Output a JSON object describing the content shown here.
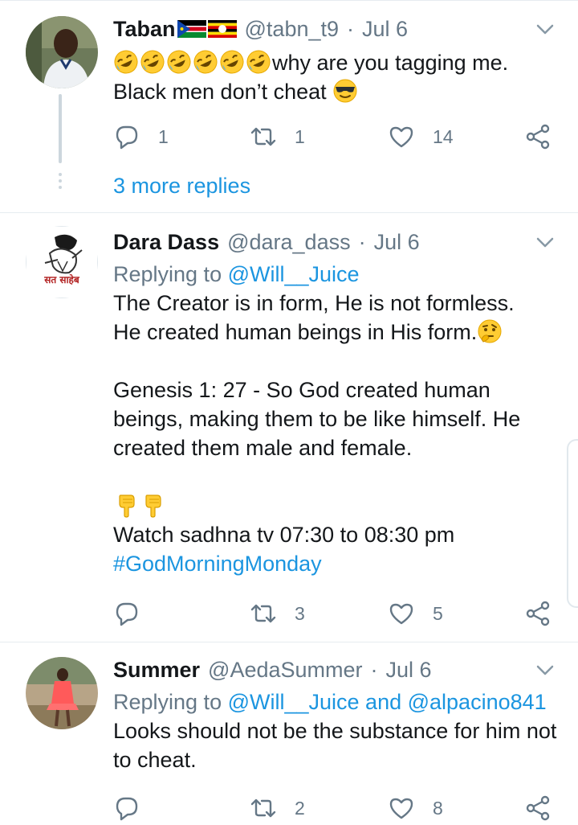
{
  "tweets": [
    {
      "name": "Taban",
      "handle": "@tabn_t9",
      "separator": "·",
      "date": "Jul 6",
      "flags": [
        "south-sudan-flag",
        "uganda-flag"
      ],
      "text_line1": "why are you tagging me.",
      "text_line2": "Black men don’t cheat",
      "emojis": [
        "rolling-laughing-emoji",
        "rolling-laughing-emoji",
        "rolling-laughing-emoji",
        "rolling-laughing-emoji",
        "rolling-laughing-emoji",
        "rolling-laughing-emoji",
        "sunglasses-emoji"
      ],
      "replies": "1",
      "retweets": "1",
      "likes": "14",
      "more_replies": "3 more replies"
    },
    {
      "name": "Dara Dass",
      "handle": "@dara_dass",
      "separator": "·",
      "date": "Jul 6",
      "avatar_caption": "सत साहेब",
      "replying_prefix": "Replying to",
      "replying_to": "@Will__Juice",
      "para1_line1": "The Creator is in form, He is not formless.",
      "para1_line2": "He created human beings in His form.",
      "para2": "Genesis 1: 27 - So God created human beings, making them to be like himself. He created them male and female.",
      "watch_line": "Watch sadhna tv 07:30 to 08:30 pm",
      "hashtag": "#GodMorningMonday",
      "emojis": [
        "thinking-emoji",
        "pointing-down-emoji",
        "pointing-down-emoji"
      ],
      "replies": "",
      "retweets": "3",
      "likes": "5"
    },
    {
      "name": "Summer",
      "handle": "@AedaSummer",
      "separator": "·",
      "date": "Jul 6",
      "replying_prefix": "Replying to",
      "replying_to": "@Will__Juice and @alpacino841",
      "text": "Looks should not be the substance for him not to cheat.",
      "replies": "",
      "retweets": "2",
      "likes": "8"
    }
  ],
  "colors": {
    "text": "#14171a",
    "secondary": "#657786",
    "link": "#1b95e0",
    "divider": "#e6ecf0",
    "thread_line": "#ccd6dd"
  }
}
